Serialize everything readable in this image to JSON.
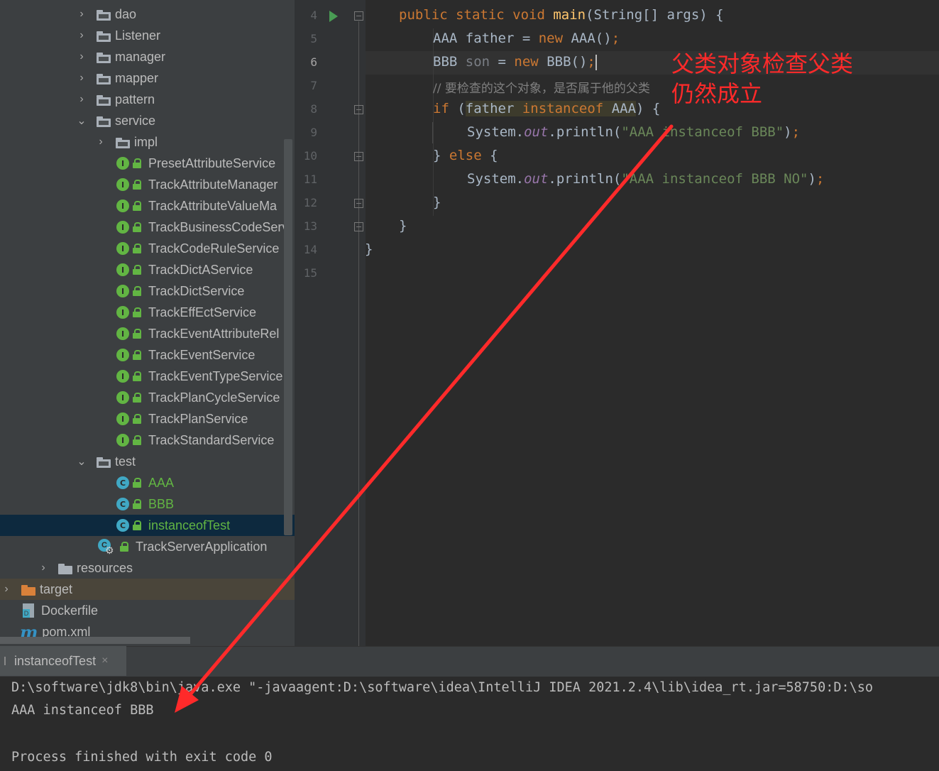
{
  "project_tree": {
    "items": [
      {
        "label": "dao",
        "expanded": false,
        "icon": "package-folder-icon"
      },
      {
        "label": "Listener",
        "expanded": false,
        "icon": "package-folder-icon"
      },
      {
        "label": "manager",
        "expanded": false,
        "icon": "package-folder-icon"
      },
      {
        "label": "mapper",
        "expanded": false,
        "icon": "package-folder-icon"
      },
      {
        "label": "pattern",
        "expanded": false,
        "icon": "package-folder-icon"
      },
      {
        "label": "service",
        "expanded": true,
        "icon": "package-folder-icon"
      },
      {
        "label": "impl",
        "expanded": false,
        "icon": "package-folder-icon"
      },
      {
        "label": "PresetAttributeService",
        "icon": "interface-icon"
      },
      {
        "label": "TrackAttributeManager",
        "icon": "interface-icon"
      },
      {
        "label": "TrackAttributeValueMa",
        "icon": "interface-icon"
      },
      {
        "label": "TrackBusinessCodeServ",
        "icon": "interface-icon"
      },
      {
        "label": "TrackCodeRuleService",
        "icon": "interface-icon"
      },
      {
        "label": "TrackDictAService",
        "icon": "interface-icon"
      },
      {
        "label": "TrackDictService",
        "icon": "interface-icon"
      },
      {
        "label": "TrackEffEctService",
        "icon": "interface-icon"
      },
      {
        "label": "TrackEventAttributeRel",
        "icon": "interface-icon"
      },
      {
        "label": "TrackEventService",
        "icon": "interface-icon"
      },
      {
        "label": "TrackEventTypeService",
        "icon": "interface-icon"
      },
      {
        "label": "TrackPlanCycleService",
        "icon": "interface-icon"
      },
      {
        "label": "TrackPlanService",
        "icon": "interface-icon"
      },
      {
        "label": "TrackStandardService",
        "icon": "interface-icon"
      },
      {
        "label": "test",
        "expanded": true,
        "icon": "package-folder-icon"
      },
      {
        "label": "AAA",
        "icon": "class-icon"
      },
      {
        "label": "BBB",
        "icon": "class-icon"
      },
      {
        "label": "instanceofTest",
        "icon": "runnable-class-icon",
        "selected": true
      },
      {
        "label": "TrackServerApplication",
        "icon": "spring-app-icon"
      },
      {
        "label": "resources",
        "expanded": false,
        "icon": "resources-folder-icon"
      },
      {
        "label": "target",
        "expanded": false,
        "icon": "excluded-folder-icon"
      },
      {
        "label": "Dockerfile",
        "icon": "docker-icon"
      },
      {
        "label": "pom.xml",
        "icon": "maven-icon"
      }
    ]
  },
  "editor": {
    "line_numbers": [
      "4",
      "5",
      "6",
      "7",
      "8",
      "9",
      "10",
      "11",
      "12",
      "13",
      "14",
      "15"
    ],
    "current_line": "6",
    "lines": {
      "l4": {
        "kw1": "public static void ",
        "fn": "main",
        "rest": "(String[] args) {"
      },
      "l5": {
        "a": "AAA father = ",
        "kw": "new ",
        "b": "AAA()",
        "semi": ";"
      },
      "l6": {
        "a": "BBB ",
        "var": "son",
        "b": " = ",
        "kw": "new ",
        "c": "BBB()",
        "semi": ";"
      },
      "l7": {
        "comment": "// 要检查的这个对象，是否属于他的父类"
      },
      "l8": {
        "kw": "if ",
        "p": "(",
        "hl": "father ",
        "kw2": "instanceof",
        "hl2": " AAA",
        "rest": ") {"
      },
      "l9": {
        "a": "System.",
        "fld": "out",
        "b": ".println(",
        "str": "\"AAA instanceof BBB\"",
        "c": ")",
        "semi": ";"
      },
      "l10": {
        "a": "} ",
        "kw": "else",
        "b": " {"
      },
      "l11": {
        "a": "System.",
        "fld": "out",
        "b": ".println(",
        "str": "\"AAA instanceof BBB NO\"",
        "c": ")",
        "semi": ";"
      },
      "l12": {
        "a": "}"
      },
      "l13": {
        "a": "}"
      },
      "l14": {
        "a": "}"
      }
    }
  },
  "annotation": {
    "line1": "父类对象检查父类",
    "line2": "仍然成立",
    "color": "#ff2a2a"
  },
  "run_panel": {
    "tab_label": "instanceofTest",
    "close_icon": "×",
    "console_lines": [
      "D:\\software\\jdk8\\bin\\java.exe \"-javaagent:D:\\software\\idea\\IntelliJ IDEA 2021.2.4\\lib\\idea_rt.jar=58750:D:\\so",
      "AAA instanceof BBB",
      "",
      "Process finished with exit code 0"
    ]
  },
  "colors": {
    "keyword": "#cc7832",
    "function": "#ffc66d",
    "string": "#6a8759",
    "field": "#9876aa",
    "comment": "#808080",
    "selection": "#0d293e"
  }
}
